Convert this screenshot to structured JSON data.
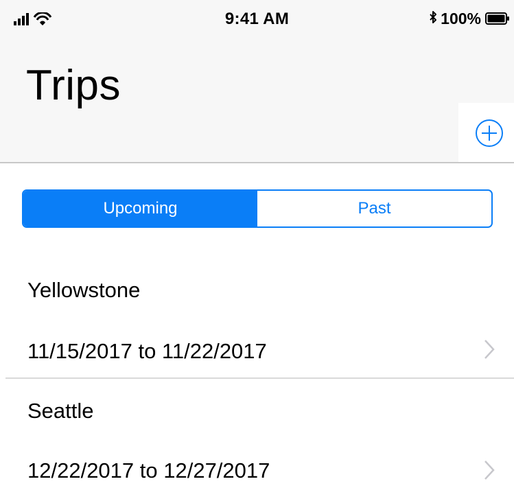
{
  "status_bar": {
    "time": "9:41 AM",
    "battery": "100%",
    "icons": [
      "signal-bars-icon",
      "wifi-icon",
      "bluetooth-icon",
      "battery-icon"
    ]
  },
  "nav": {
    "title": "Trips",
    "add_icon": "plus-circle-icon"
  },
  "segmented_control": {
    "segments": [
      {
        "label": "Upcoming",
        "selected": true
      },
      {
        "label": "Past",
        "selected": false
      }
    ]
  },
  "trips": [
    {
      "name": "Yellowstone",
      "dates": "11/15/2017 to 11/22/2017"
    },
    {
      "name": "Seattle",
      "dates": "12/22/2017 to 12/27/2017"
    }
  ],
  "colors": {
    "accent": "#0a7ef7",
    "bar_background": "#f7f7f7",
    "divider": "#d9d9d9",
    "chevron": "#c7c7cc"
  }
}
